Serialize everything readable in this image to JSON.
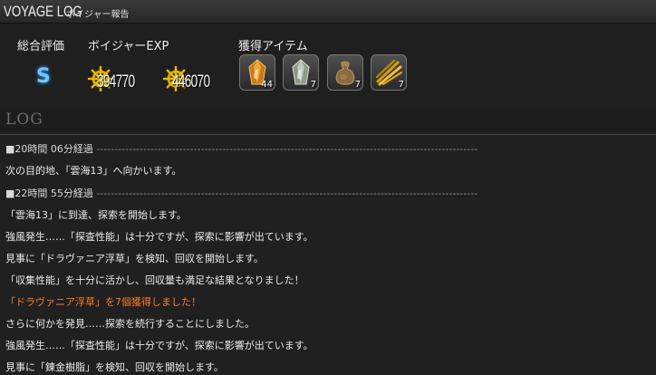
{
  "window": {
    "title": "VOYAGE LOG",
    "subtitle": "ボイジャー報告"
  },
  "summary": {
    "rating_label": "総合評価",
    "rating_value": "S",
    "exp_label": "ボイジャーEXP",
    "exp_values": [
      "394770",
      "446070"
    ],
    "items_label": "獲得アイテム",
    "items": [
      {
        "icon": "amber-crystal-icon",
        "quantity": "44"
      },
      {
        "icon": "clear-crystal-icon",
        "quantity": "7"
      },
      {
        "icon": "sack-icon",
        "quantity": "7"
      },
      {
        "icon": "gold-twigs-icon",
        "quantity": "7"
      }
    ]
  },
  "log": {
    "title": "LOG",
    "entries": [
      {
        "text": "■20時間 06分経過",
        "dashes": "----------------------------------------------------------------------------------------------------------",
        "type": "section"
      },
      {
        "text": "次の目的地、「雲海13」へ向かいます。",
        "type": "normal"
      },
      {
        "text": "■22時間 55分経過",
        "dashes": "----------------------------------------------------------------------------------------------------------",
        "type": "section"
      },
      {
        "text": "「雲海13」に到達、探索を開始します。",
        "type": "normal"
      },
      {
        "text": "強風発生……「探査性能」は十分ですが、探索に影響が出ています。",
        "type": "normal"
      },
      {
        "text": "見事に「ドラヴァニア浮草」を検知、回収を開始します。",
        "type": "normal"
      },
      {
        "text": "「収集性能」を十分に活かし、回収量も満足な結果となりました！",
        "type": "normal"
      },
      {
        "text": "「ドラヴァニア浮草」を7個獲得しました！",
        "type": "highlight"
      },
      {
        "text": "さらに何かを発見……探索を続行することにしました。",
        "type": "normal"
      },
      {
        "text": "強風発生……「探査性能」は十分ですが、探索に影響が出ています。",
        "type": "normal"
      },
      {
        "text": "見事に「錬金樹脂」を検知、回収を開始します。",
        "type": "normal"
      }
    ]
  },
  "colors": {
    "background": "#202020",
    "rating": "#6ec6ff",
    "highlight": "#ff7a2a"
  }
}
